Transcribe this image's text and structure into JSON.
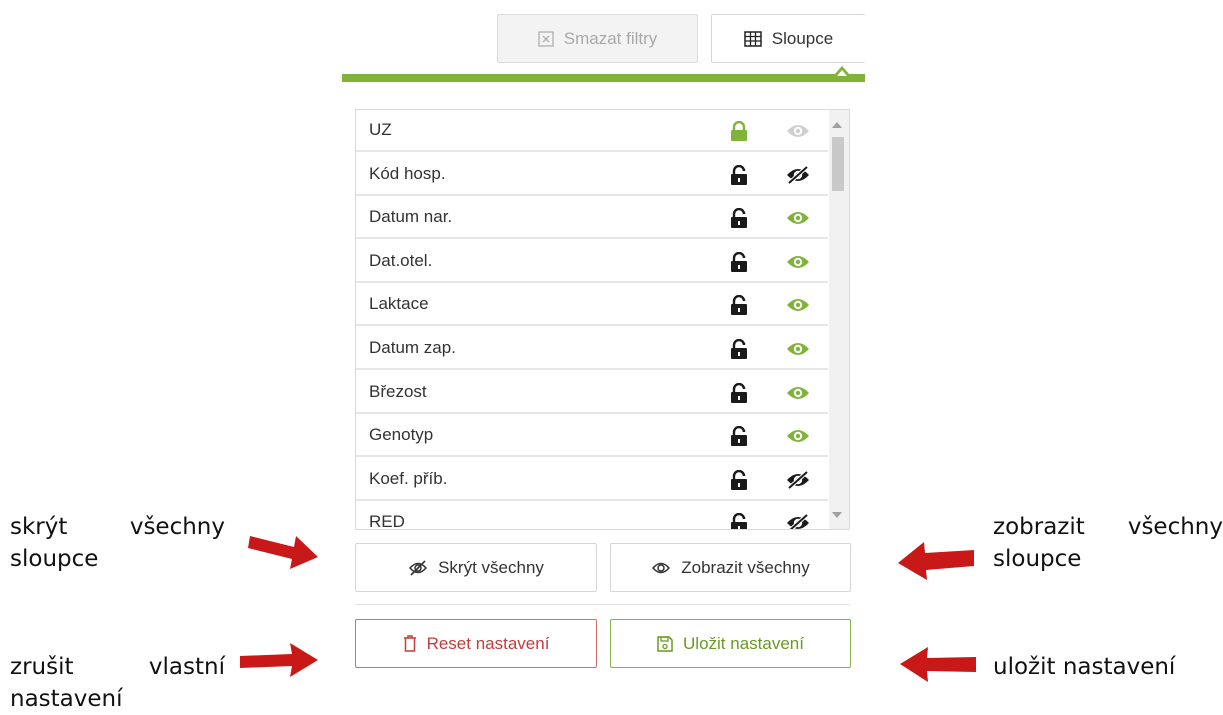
{
  "toolbar": {
    "clear_filters_label": "Smazat filtry",
    "columns_label": "Sloupce",
    "accent_color": "#7fb33a"
  },
  "columns": [
    {
      "label": "UZ",
      "locked": true,
      "visible": true
    },
    {
      "label": "Kód hosp.",
      "locked": false,
      "visible": false
    },
    {
      "label": "Datum nar.",
      "locked": false,
      "visible": true
    },
    {
      "label": "Dat.otel.",
      "locked": false,
      "visible": true
    },
    {
      "label": "Laktace",
      "locked": false,
      "visible": true
    },
    {
      "label": "Datum zap.",
      "locked": false,
      "visible": true
    },
    {
      "label": "Březost",
      "locked": false,
      "visible": true
    },
    {
      "label": "Genotyp",
      "locked": false,
      "visible": true
    },
    {
      "label": "Koef. příb.",
      "locked": false,
      "visible": false
    },
    {
      "label": "RED",
      "locked": false,
      "visible": false
    }
  ],
  "actions": {
    "hide_all_label": "Skrýt všechny",
    "show_all_label": "Zobrazit všechny",
    "reset_label": "Reset nastavení",
    "save_label": "Uložit nastavení"
  },
  "annotations": {
    "hide_all": "skrýt všechny sloupce",
    "show_all": "zobrazit všechny sloupce",
    "reset": "zrušit vlastní nastavení",
    "save": "uložit nastavení",
    "arrow_color": "#c81818"
  }
}
